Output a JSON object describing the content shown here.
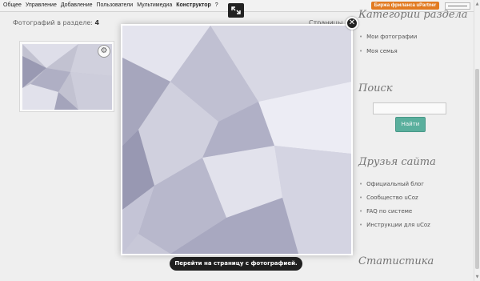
{
  "toolbar": {
    "menu": [
      "Общее",
      "Управление",
      "Добавление",
      "Пользователи",
      "Мультимедиа",
      "Конструктор",
      "?"
    ],
    "promo": "Биржа фриланса uPartner"
  },
  "content": {
    "photos_label": "Фотографий в разделе:",
    "photos_count": "4",
    "pages_label": "Страницы"
  },
  "sidebar": {
    "categories_title": "Категории раздела",
    "categories": [
      "Мои фотографии",
      "Моя семья"
    ],
    "search_title": "Поиск",
    "search_button": "Найти",
    "friends_title": "Друзья сайта",
    "friends": [
      "Официальный блог",
      "Сообщество uCoz",
      "FAQ по системе",
      "Инструкции для uCoz"
    ],
    "stats_title": "Статистика"
  },
  "lightbox": {
    "close_symbol": "✕",
    "caption": "Перейти на страницу с фотографией."
  },
  "colors": {
    "promo": "#e77e22",
    "search_button": "#5cb3a1",
    "caption_bg": "#1f1f1f"
  }
}
